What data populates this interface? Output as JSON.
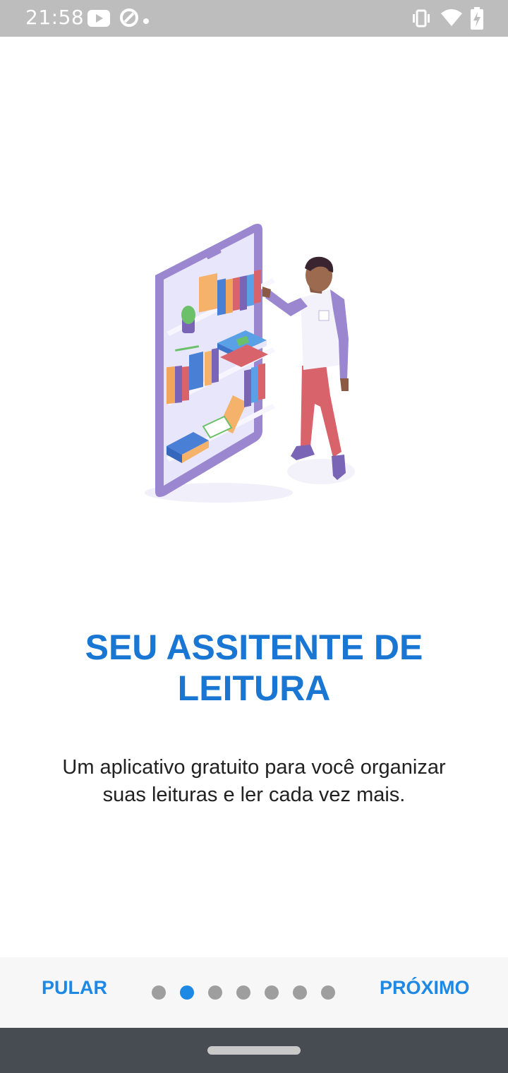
{
  "status_bar": {
    "time": "21:58",
    "left_icons": [
      "youtube-icon",
      "data-saver-icon",
      "dot-icon"
    ],
    "right_icons": [
      "vibrate-icon",
      "wifi-icon",
      "battery-charging-icon"
    ]
  },
  "onboarding": {
    "illustration": "person-reading-bookshelf-phone",
    "title": "SEU ASSITENTE DE LEITURA",
    "description": "Um aplicativo gratuito para você organizar suas leituras e ler cada vez mais.",
    "current_page": 2,
    "total_pages": 7
  },
  "footer": {
    "skip_label": "PULAR",
    "next_label": "PRÓXIMO"
  },
  "colors": {
    "accent": "#1e88e5",
    "title": "#1976d2",
    "status_bar": "#bdbdbd",
    "nav_bar": "#474c53"
  }
}
